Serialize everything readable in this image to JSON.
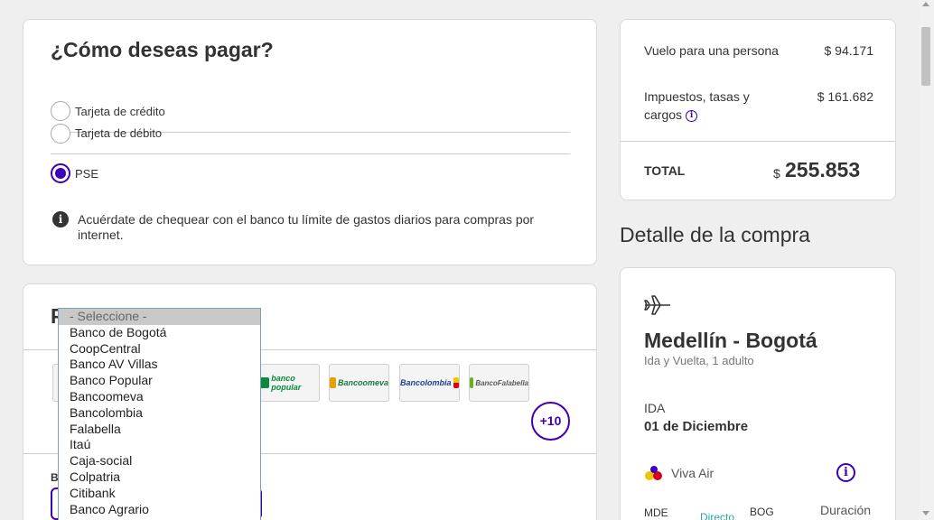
{
  "payment": {
    "title": "¿Cómo deseas pagar?",
    "options": [
      {
        "label": "Tarjeta de crédito",
        "selected": false
      },
      {
        "label": "Tarjeta de débito",
        "selected": false
      },
      {
        "label": "PSE",
        "selected": true
      }
    ],
    "notice": "Acuérdate de chequear con el banco tu límite de gastos diarios para compras por internet.",
    "notice_icon": "info-circle-icon"
  },
  "pse": {
    "title": "PSE",
    "bank_logos": [
      {
        "name": "banco popular",
        "color": "#0a8a3c"
      },
      {
        "name": "Bancoomeva",
        "color": "#1a7a3a"
      },
      {
        "name": "Bancolombia",
        "color": "#1c3f94"
      },
      {
        "name": "BancoFalabella",
        "color": "#5a5a5a"
      }
    ],
    "more_label": "+10",
    "banco_label": "B"
  },
  "dropdown": {
    "options": [
      "- Seleccione -",
      "Banco de Bogotá",
      "CoopCentral",
      "Banco AV Villas",
      "Banco Popular",
      "Bancoomeva",
      "Bancolombia",
      "Falabella",
      "Itaú",
      "Caja-social",
      "Colpatria",
      "Citibank",
      "Banco Agrario"
    ],
    "selected_index": 0
  },
  "summary": {
    "flight_label": "Vuelo para una persona",
    "flight_value": "$ 94.171",
    "taxes_label": "Impuestos, tasas y cargos",
    "taxes_value": "$ 161.682",
    "total_label": "TOTAL",
    "total_currency": "$",
    "total_value": "255.853"
  },
  "detail": {
    "heading": "Detalle de la compra",
    "route": "Medellín - Bogotá",
    "trip_desc": "Ida y Vuelta, 1 adulto",
    "ida_label": "IDA",
    "ida_date": "01 de Diciembre",
    "airline": "Viva Air",
    "origin_code": "MDE",
    "direct_label": "Directo",
    "dest_code": "BOG",
    "duration_label": "Duración"
  },
  "colors": {
    "accent": "#3d00b8",
    "direct": "#2aa5a5"
  }
}
